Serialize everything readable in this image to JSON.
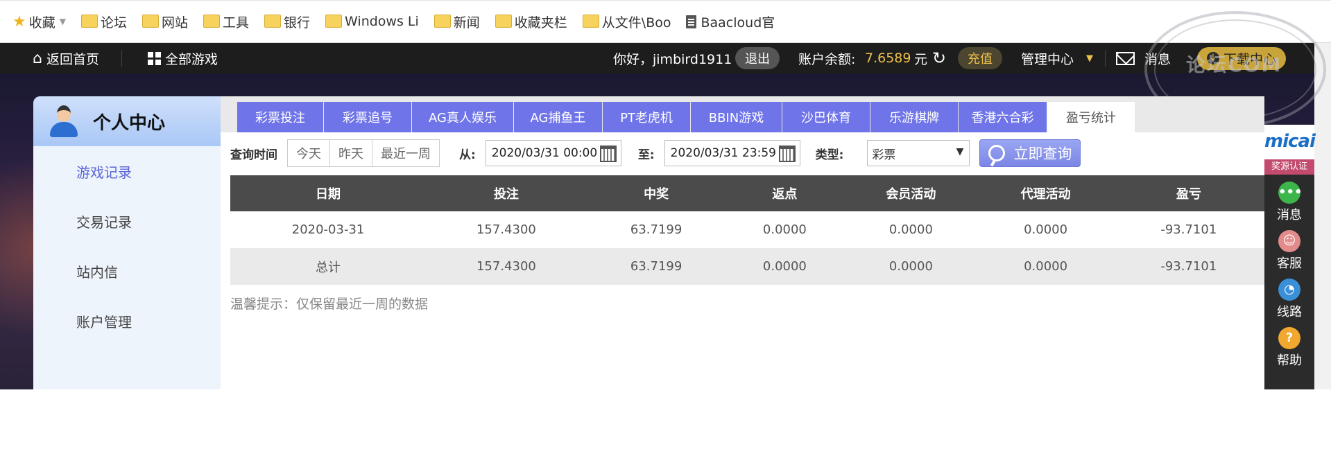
{
  "bookmarks": [
    {
      "label": "收藏",
      "type": "star"
    },
    {
      "label": "论坛",
      "type": "folder"
    },
    {
      "label": "网站",
      "type": "folder"
    },
    {
      "label": "工具",
      "type": "folder"
    },
    {
      "label": "银行",
      "type": "folder"
    },
    {
      "label": "Windows Li",
      "type": "folder"
    },
    {
      "label": "新闻",
      "type": "folder"
    },
    {
      "label": "收藏夹栏",
      "type": "folder"
    },
    {
      "label": "从文件\\Boo",
      "type": "folder"
    },
    {
      "label": "Baacloud官",
      "type": "page"
    }
  ],
  "topnav": {
    "home": "返回首页",
    "games": "全部游戏",
    "hello": "你好，jimbird1911",
    "logout": "退出",
    "balance_label": "账户余额:",
    "balance": "7.6589",
    "currency": "元",
    "recharge": "充值",
    "admin": "管理中心",
    "message": "消息",
    "download": "下载中心"
  },
  "left_panel": {
    "title": "个人中心",
    "items": [
      "游戏记录",
      "交易记录",
      "站内信",
      "账户管理"
    ],
    "active_index": 0
  },
  "tabs": [
    "彩票投注",
    "彩票追号",
    "AG真人娱乐",
    "AG捕鱼王",
    "PT老虎机",
    "BBIN游戏",
    "沙巴体育",
    "乐游棋牌",
    "香港六合彩",
    "盈亏统计"
  ],
  "query": {
    "label": "查询时间",
    "quick": [
      "今天",
      "昨天",
      "最近一周"
    ],
    "from_label": "从:",
    "from_value": "2020/03/31 00:00",
    "to_label": "至:",
    "to_value": "2020/03/31 23:59",
    "type_label": "类型:",
    "type_value": "彩票",
    "search_button": "立即查询"
  },
  "table": {
    "headers": [
      "日期",
      "投注",
      "中奖",
      "返点",
      "会员活动",
      "代理活动",
      "盈亏"
    ],
    "rows": [
      [
        "2020-03-31",
        "157.4300",
        "63.7199",
        "0.0000",
        "0.0000",
        "0.0000",
        "-93.7101"
      ]
    ],
    "total": [
      "总计",
      "157.4300",
      "63.7199",
      "0.0000",
      "0.0000",
      "0.0000",
      "-93.7101"
    ]
  },
  "tip": "温馨提示：仅保留最近一周的数据",
  "sidebar": {
    "logo": "micai",
    "badge": "奖源认证",
    "items": [
      {
        "label": "消息",
        "icon": "chat-icon",
        "color": "#3cb54a"
      },
      {
        "label": "客服",
        "icon": "support-icon",
        "color": "#e38b8b"
      },
      {
        "label": "线路",
        "icon": "speedometer-icon",
        "color": "#3a8fd9"
      },
      {
        "label": "帮助",
        "icon": "help-icon",
        "color": "#f2a72e"
      }
    ]
  },
  "watermark": "论坛COM",
  "colors": {
    "tab_bg": "#6f74e8",
    "balance": "#f0c14b",
    "active_menu": "#5a64d8"
  }
}
